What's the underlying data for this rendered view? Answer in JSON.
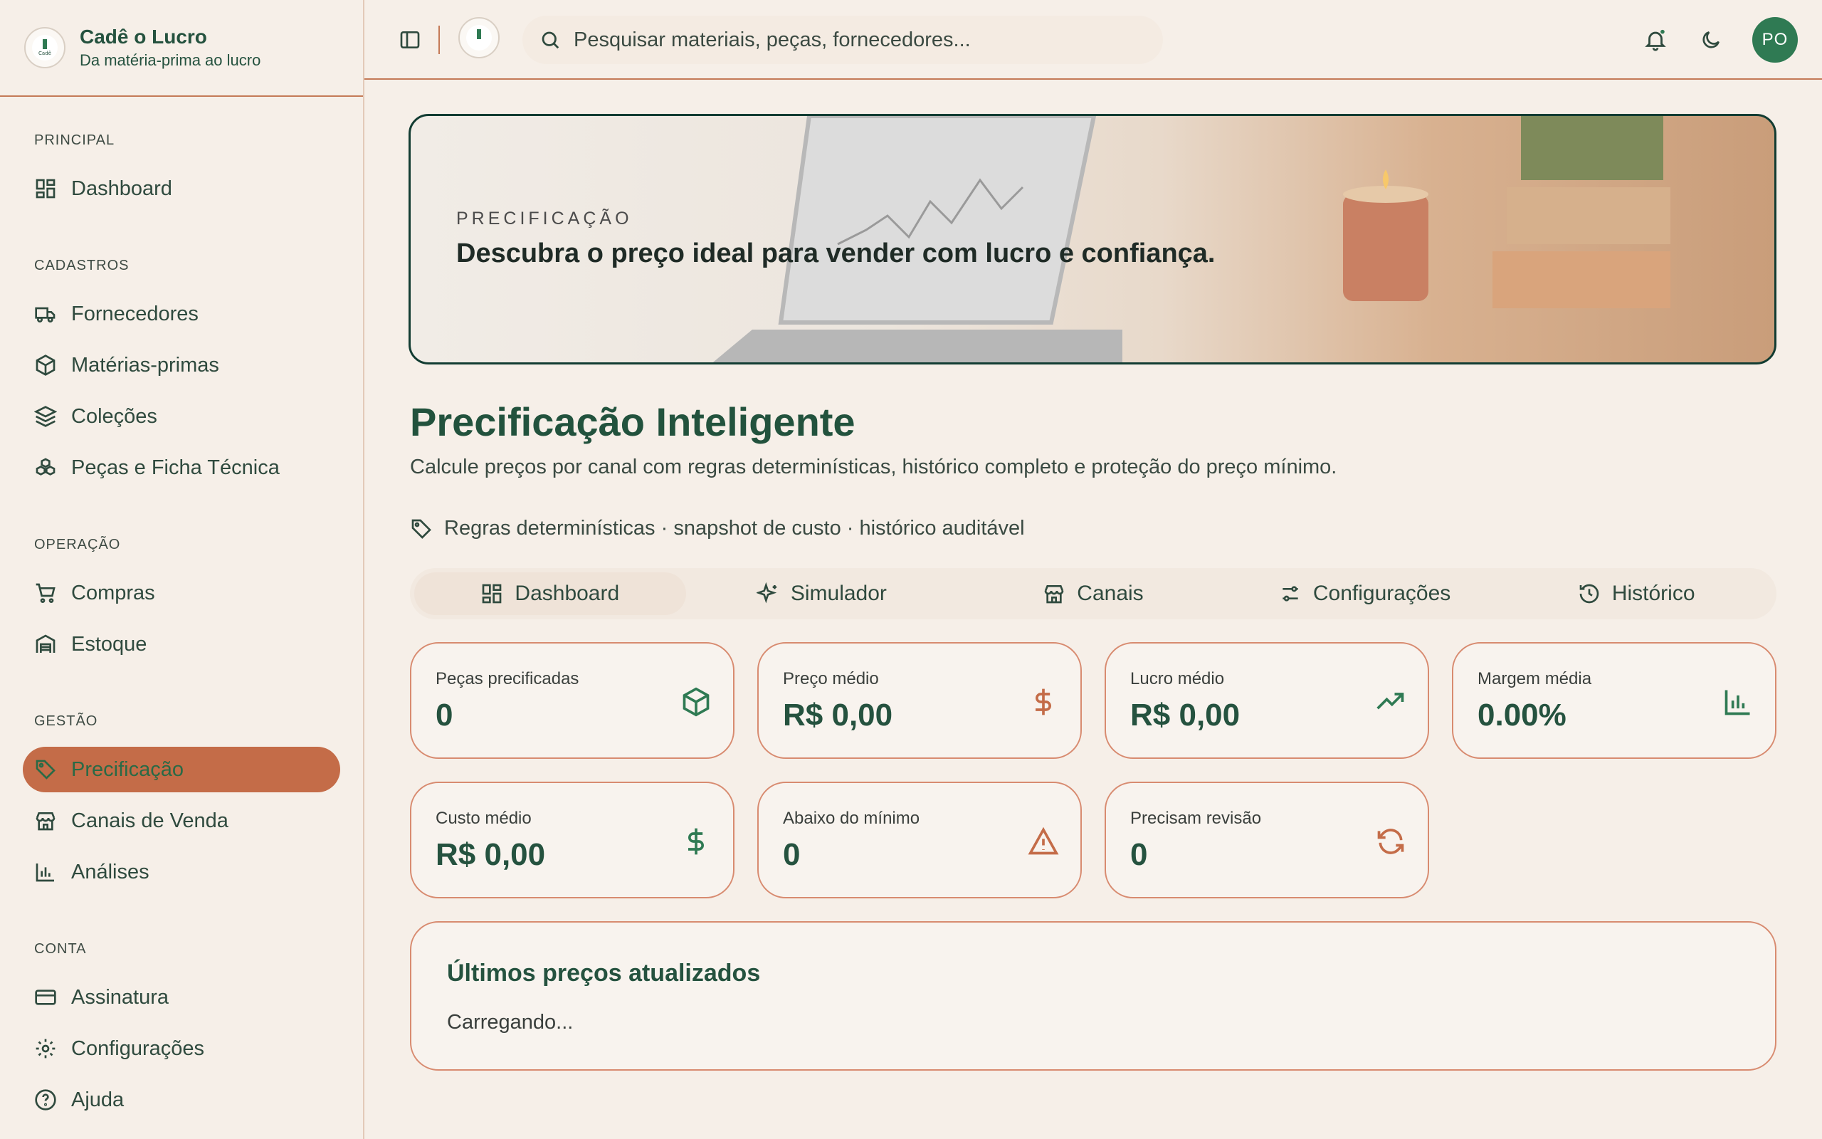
{
  "brand": {
    "title": "Cadê o Lucro",
    "subtitle": "Da matéria-prima ao lucro"
  },
  "sidebar": {
    "sections": [
      {
        "label": "PRINCIPAL",
        "items": [
          {
            "label": "Dashboard",
            "icon": "dashboard-icon"
          }
        ]
      },
      {
        "label": "CADASTROS",
        "items": [
          {
            "label": "Fornecedores",
            "icon": "truck-icon"
          },
          {
            "label": "Matérias-primas",
            "icon": "package-icon"
          },
          {
            "label": "Coleções",
            "icon": "layers-icon"
          },
          {
            "label": "Peças e Ficha Técnica",
            "icon": "boxes-icon"
          }
        ]
      },
      {
        "label": "OPERAÇÃO",
        "items": [
          {
            "label": "Compras",
            "icon": "cart-icon"
          },
          {
            "label": "Estoque",
            "icon": "warehouse-icon"
          }
        ]
      },
      {
        "label": "GESTÃO",
        "items": [
          {
            "label": "Precificação",
            "icon": "tag-icon",
            "active": true
          },
          {
            "label": "Canais de Venda",
            "icon": "store-icon"
          },
          {
            "label": "Análises",
            "icon": "bar-chart-icon"
          }
        ]
      },
      {
        "label": "CONTA",
        "items": [
          {
            "label": "Assinatura",
            "icon": "credit-card-icon"
          },
          {
            "label": "Configurações",
            "icon": "gear-icon"
          },
          {
            "label": "Ajuda",
            "icon": "help-icon"
          }
        ]
      }
    ]
  },
  "topbar": {
    "search_placeholder": "Pesquisar materiais, peças, fornecedores...",
    "avatar_initials": "PO"
  },
  "hero": {
    "kicker": "PRECIFICAÇÃO",
    "title": "Descubra o preço ideal para vender com lucro e confiança."
  },
  "page": {
    "title": "Precificação Inteligente",
    "subtitle": "Calcule preços por canal com regras determinísticas, histórico completo e proteção do preço mínimo.",
    "tags": "Regras determinísticas · snapshot de custo · histórico auditável"
  },
  "tabs": [
    {
      "label": "Dashboard",
      "icon": "dashboard-icon",
      "active": true
    },
    {
      "label": "Simulador",
      "icon": "sparkles-icon"
    },
    {
      "label": "Canais",
      "icon": "store-icon"
    },
    {
      "label": "Configurações",
      "icon": "sliders-icon"
    },
    {
      "label": "Histórico",
      "icon": "history-icon"
    }
  ],
  "stats": [
    {
      "label": "Peças precificadas",
      "value": "0",
      "icon": "package-icon",
      "color": "#2f7a53"
    },
    {
      "label": "Preço médio",
      "value": "R$ 0,00",
      "icon": "dollar-icon",
      "color": "#c46c48"
    },
    {
      "label": "Lucro médio",
      "value": "R$ 0,00",
      "icon": "trending-up-icon",
      "color": "#2f7a53"
    },
    {
      "label": "Margem média",
      "value": "0.00%",
      "icon": "bar-chart-icon",
      "color": "#2f7a53"
    },
    {
      "label": "Custo médio",
      "value": "R$ 0,00",
      "icon": "dollar-icon",
      "color": "#2f7a53"
    },
    {
      "label": "Abaixo do mínimo",
      "value": "0",
      "icon": "alert-triangle-icon",
      "color": "#c46c48"
    },
    {
      "label": "Precisam revisão",
      "value": "0",
      "icon": "refresh-icon",
      "color": "#c46c48"
    }
  ],
  "recent": {
    "title": "Últimos preços atualizados",
    "status": "Carregando..."
  }
}
